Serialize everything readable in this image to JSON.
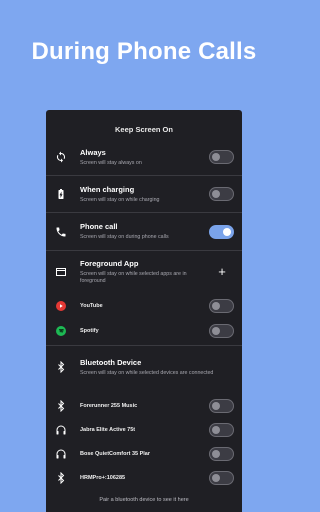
{
  "headline": "During Phone Calls",
  "screen": {
    "title": "Keep Screen On",
    "always": {
      "title": "Always",
      "subtitle": "Screen will stay always on",
      "on": false
    },
    "charging": {
      "title": "When charging",
      "subtitle": "Screen will stay on while charging",
      "on": false
    },
    "phone_call": {
      "title": "Phone call",
      "subtitle": "Screen will stay on during phone calls",
      "on": true
    },
    "foreground": {
      "title": "Foreground App",
      "subtitle": "Screen will stay on while selected apps are in foreground",
      "add_label": "+"
    },
    "apps": [
      {
        "name": "YouTube",
        "icon": "youtube-icon",
        "color": "#e53935",
        "on": false
      },
      {
        "name": "Spotify",
        "icon": "spotify-icon",
        "color": "#1db954",
        "on": false
      }
    ],
    "bluetooth": {
      "title": "Bluetooth Device",
      "subtitle": "Screen will stay on while selected devices are connected"
    },
    "devices": [
      {
        "name": "Forerunner 255 Music",
        "icon": "bluetooth-icon",
        "on": false
      },
      {
        "name": "Jabra Elite Active 75t",
        "icon": "headphones-icon",
        "on": false
      },
      {
        "name": "Bose QuietComfort 35 Plar",
        "icon": "headphones-icon",
        "on": false
      },
      {
        "name": "HRMPro+:106285",
        "icon": "bluetooth-icon",
        "on": false
      }
    ],
    "footer": "Pair a bluetooth device to see it here"
  },
  "colors": {
    "background": "#7ea7f0",
    "panel": "#1f1f24",
    "accent": "#7aa3ea"
  }
}
